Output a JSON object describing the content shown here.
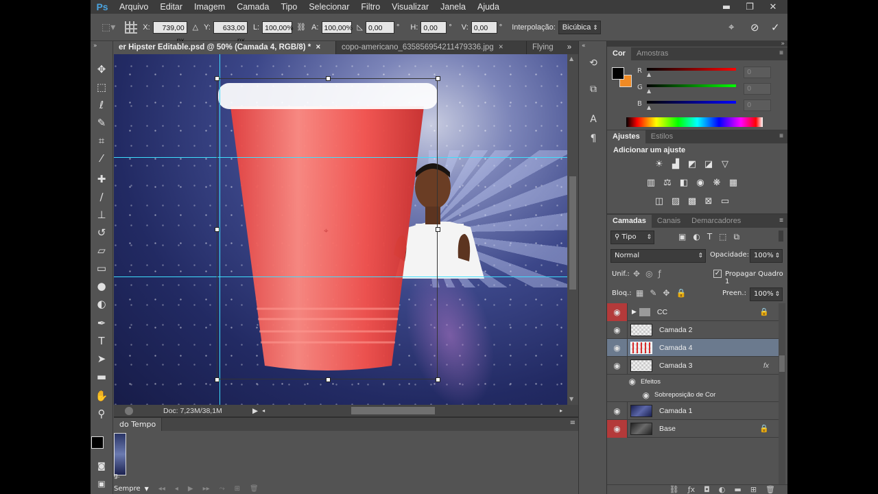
{
  "app": {
    "logo": "Ps",
    "menu": [
      "Arquivo",
      "Editar",
      "Imagem",
      "Camada",
      "Tipo",
      "Selecionar",
      "Filtro",
      "Visualizar",
      "Janela",
      "Ajuda"
    ],
    "window_controls": {
      "minimize": "▬",
      "restore": "❐",
      "close": "✕"
    }
  },
  "options": {
    "x_label": "X:",
    "x_value": "739,00 px",
    "y_label": "Y:",
    "y_value": "633,00 px",
    "w_label": "L:",
    "w_value": "100,00%",
    "h_label": "A:",
    "h_value": "100,00%",
    "angle_value": "0,00",
    "angle_unit": "°",
    "hskew_label": "H:",
    "hskew_value": "0,00",
    "hskew_unit": "°",
    "vskew_label": "V:",
    "vskew_value": "0,00",
    "vskew_unit": "°",
    "interp_label": "Interpolação:",
    "interp_value": "Bicúbica"
  },
  "tabs": [
    {
      "label": "er Hipster Editable.psd @ 50% (Camada 4, RGB/8) *",
      "active": true,
      "close": "×"
    },
    {
      "label": "copo-americano_635856954211479336.jpg",
      "active": false,
      "close": "×"
    },
    {
      "label": "Flying",
      "active": false
    }
  ],
  "tabs_more": "»",
  "status": {
    "doc": "Doc: 7,23M/38,1M"
  },
  "timeline": {
    "tab": "do Tempo",
    "loop": "Sempre",
    "frame_label": "g."
  },
  "color_panel": {
    "tabs": [
      "Cor",
      "Amostras"
    ],
    "channels": [
      {
        "label": "R",
        "value": "0",
        "color": "#ff0000"
      },
      {
        "label": "G",
        "value": "0",
        "color": "#00ff00"
      },
      {
        "label": "B",
        "value": "0",
        "color": "#0000ff"
      }
    ],
    "foreground": "#000000",
    "background": "#f08a24"
  },
  "adjustments_panel": {
    "tabs": [
      "Ajustes",
      "Estilos"
    ],
    "heading": "Adicionar um ajuste"
  },
  "layers_panel": {
    "tabs": [
      "Camadas",
      "Canais",
      "Demarcadores"
    ],
    "filter": "Tipo",
    "blend_mode": "Normal",
    "opacity_label": "Opacidade:",
    "opacity": "100%",
    "unify_label": "Unif.:",
    "propagate_label": "Propagar Quadro 1",
    "lock_label": "Bloq.:",
    "fill_label": "Preen.:",
    "fill": "100%",
    "layers": [
      {
        "name": "CC",
        "type": "group",
        "locked": true,
        "eye_red": true
      },
      {
        "name": "Camada 2",
        "type": "layer"
      },
      {
        "name": "Camada 4",
        "type": "layer",
        "selected": true
      },
      {
        "name": "Camada 3",
        "type": "layer",
        "fx": "fx"
      },
      {
        "name": "Efeitos",
        "type": "effects-header"
      },
      {
        "name": "Sobreposição de Cor",
        "type": "effect"
      },
      {
        "name": "Camada 1",
        "type": "layer"
      },
      {
        "name": "Base",
        "type": "layer",
        "locked": true,
        "eye_red": true
      }
    ]
  }
}
